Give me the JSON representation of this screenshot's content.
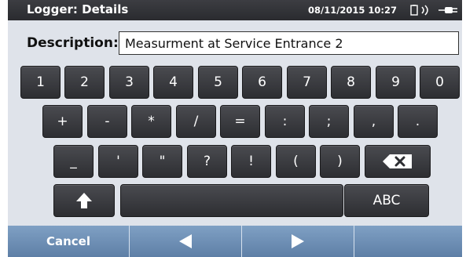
{
  "title_bar": {
    "title": "Logger: Details",
    "datetime": "08/11/2015 10:27",
    "icons": [
      "battery-icon",
      "wireless-icon",
      "power-plug-icon"
    ]
  },
  "description": {
    "label": "Description:",
    "value": "Measurment at Service Entrance 2"
  },
  "keyboard": {
    "row1": [
      "1",
      "2",
      "3",
      "4",
      "5",
      "6",
      "7",
      "8",
      "9",
      "0"
    ],
    "row2": [
      "+",
      "-",
      "*",
      "/",
      "=",
      ":",
      ";",
      ",",
      "."
    ],
    "row3": [
      "_",
      "'",
      "\"",
      "?",
      "!",
      "(",
      ")"
    ],
    "backspace_icon": "backspace-icon",
    "shift_icon": "shift-up-arrow-icon",
    "space_label": "",
    "abc_label": "ABC"
  },
  "softkeys": {
    "cancel_label": "Cancel",
    "left_icon": "left-arrow-icon",
    "right_icon": "right-arrow-icon",
    "blank_label": ""
  },
  "colors": {
    "title_bar": "#2e2f33",
    "content_bg": "#dfe3ea",
    "key": "#3a3b3f",
    "softkey_bar": "#6d8fb6"
  }
}
